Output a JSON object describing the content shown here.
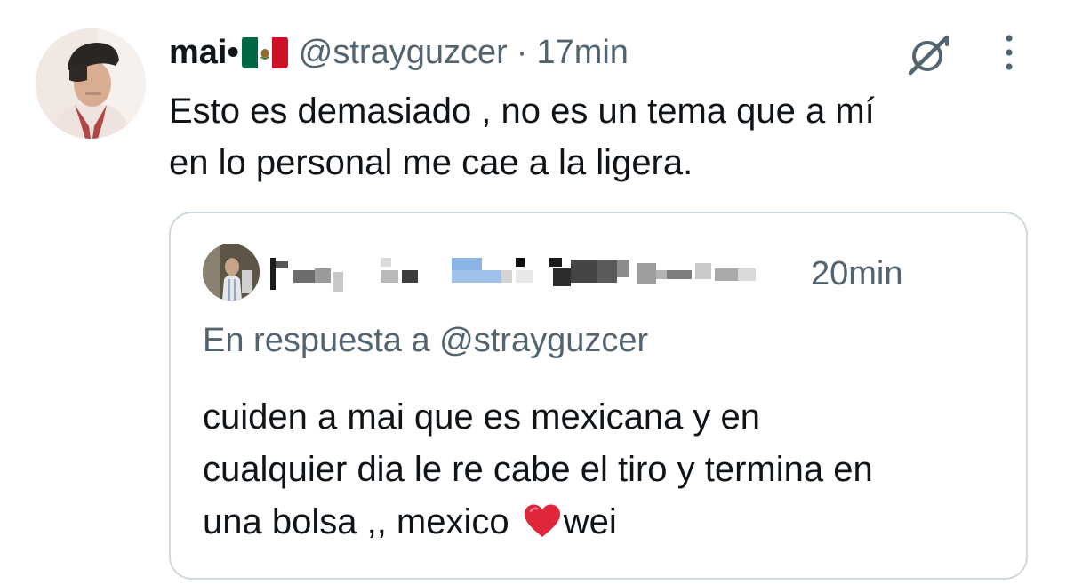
{
  "tweet": {
    "display_name": "mai•",
    "flag_icon": "mexico-flag-icon",
    "handle": "@strayguzcer",
    "separator": "·",
    "time": "17min",
    "text_line1": "Esto es demasiado , no es un tema que a mí",
    "text_line2": "en lo personal me cae a la ligera."
  },
  "quoted": {
    "author_name": "redacted",
    "time": "20min",
    "reply_to": "En respuesta a @strayguzcer",
    "text_line1": "cuiden a mai que es mexicana y en",
    "text_line2": "cualquier dia le re cabe el tiro y termina en",
    "text_line3_before": "una bolsa ,, mexico ",
    "text_line3_after": "wei",
    "emoji": "red-heart"
  },
  "colors": {
    "text": "#0f1419",
    "secondary": "#536471",
    "border": "#cfd9de",
    "heart": "#e0263b",
    "redaction_blue": "#8ab4e6"
  }
}
